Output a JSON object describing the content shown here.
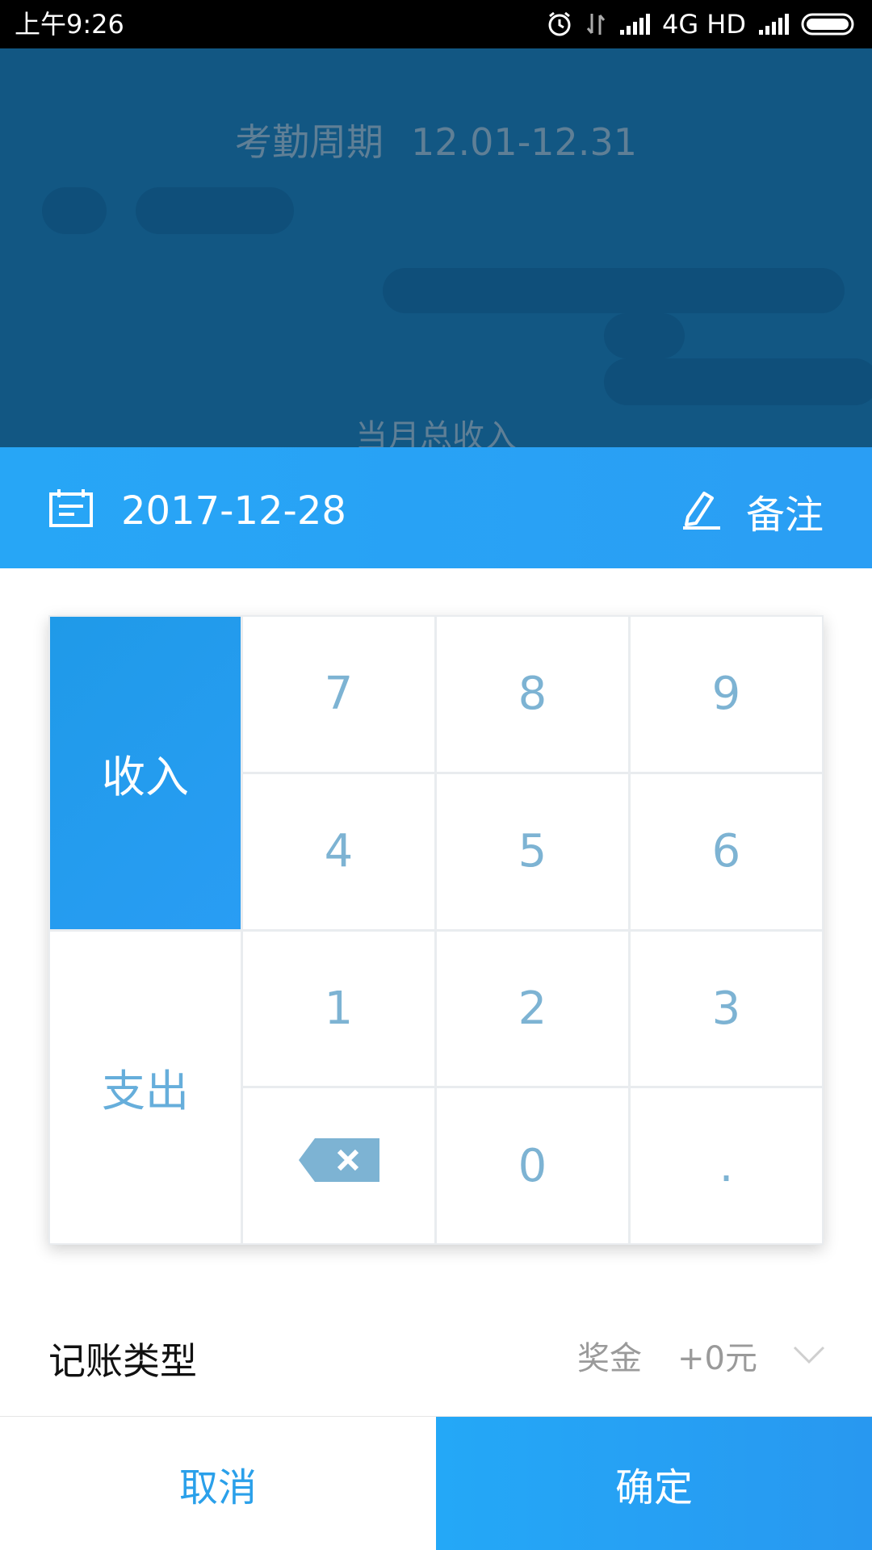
{
  "status_bar": {
    "time": "上午9:26",
    "network_label": "4G HD",
    "icons": [
      "alarm-icon",
      "data-arrows-icon",
      "signal-icon",
      "signal-icon-2",
      "battery-icon"
    ]
  },
  "background_header": {
    "period_label": "考勤周期",
    "period_value": "12.01-12.31",
    "monthly_income_label": "当月总收入"
  },
  "date_bar": {
    "date": "2017-12-28",
    "note_label": "备注",
    "icons": [
      "calendar-icon",
      "pen-icon"
    ]
  },
  "keypad": {
    "modes": {
      "income": "收入",
      "expense": "支出"
    },
    "selected_mode": "income",
    "keys": {
      "k7": "7",
      "k8": "8",
      "k9": "9",
      "k4": "4",
      "k5": "5",
      "k6": "6",
      "k1": "1",
      "k2": "2",
      "k3": "3",
      "k0": "0",
      "dot": "."
    }
  },
  "record_type": {
    "label": "记账类型",
    "category": "奖金",
    "amount": "+0元"
  },
  "actions": {
    "cancel": "取消",
    "confirm": "确定"
  },
  "colors": {
    "accent_blue": "#27a6f6",
    "key_text": "#7db3d3",
    "header_bg": "#125783"
  }
}
